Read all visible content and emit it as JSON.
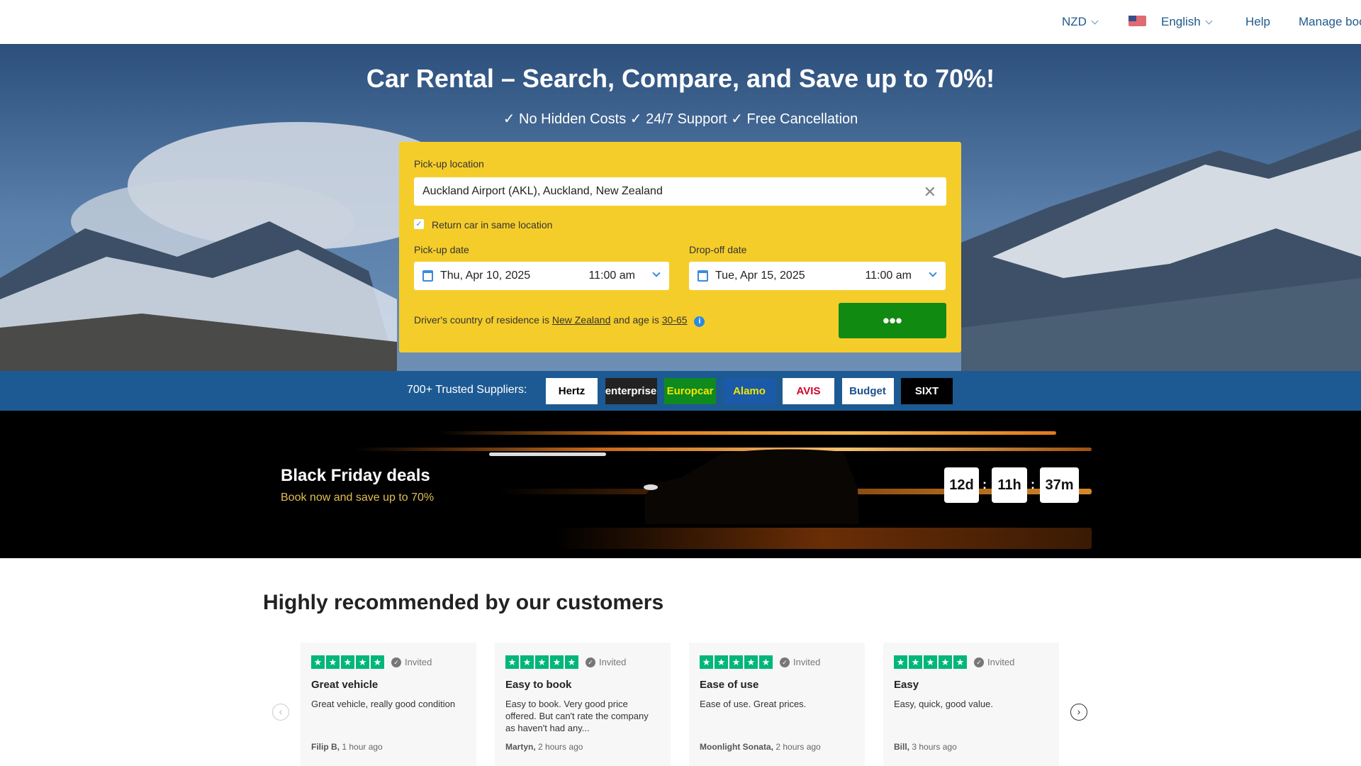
{
  "header": {
    "currency": "NZD",
    "language": "English",
    "help": "Help",
    "manage": "Manage boo"
  },
  "hero": {
    "title": "Car Rental – Search, Compare, and Save up to 70%!",
    "subtitle": "✓ No Hidden Costs ✓ 24/7 Support ✓ Free Cancellation"
  },
  "search": {
    "pickup_location_label": "Pick-up location",
    "pickup_location_value": "Auckland Airport (AKL), Auckland, New Zealand",
    "return_same_label": "Return car in same location",
    "return_same_checked": true,
    "pickup_date_label": "Pick-up date",
    "pickup_date": "Thu, Apr 10, 2025",
    "pickup_time": "11:00 am",
    "dropoff_date_label": "Drop-off date",
    "dropoff_date": "Tue, Apr 15, 2025",
    "dropoff_time": "11:00 am",
    "driver_prefix": "Driver's country of residence is",
    "driver_country": "New Zealand",
    "driver_mid": "and age is",
    "driver_age": "30-65",
    "search_button": "•••"
  },
  "suppliers": {
    "label": "700+ Trusted Suppliers:",
    "logos": [
      {
        "name": "Hertz",
        "bg": "#ffffff",
        "fg": "#000000"
      },
      {
        "name": "enterprise",
        "bg": "#222222",
        "fg": "#ffffff"
      },
      {
        "name": "Europcar",
        "bg": "#0f8a1f",
        "fg": "#f2e600"
      },
      {
        "name": "Alamo",
        "bg": "#1a5aa8",
        "fg": "#f2e600"
      },
      {
        "name": "AVIS",
        "bg": "#ffffff",
        "fg": "#d4002a"
      },
      {
        "name": "Budget",
        "bg": "#ffffff",
        "fg": "#1c4f8c"
      },
      {
        "name": "SIXT",
        "bg": "#000000",
        "fg": "#ffffff"
      }
    ]
  },
  "banner": {
    "title": "Black Friday deals",
    "subtitle": "Book now and save up to 70%",
    "countdown": [
      "12d",
      "11h",
      "37m"
    ]
  },
  "reviews": {
    "heading": "Highly recommended by our customers",
    "invited": "Invited",
    "items": [
      {
        "title": "Great vehicle",
        "text": "Great vehicle, really good condition",
        "author": "Filip B,",
        "time": "1 hour ago",
        "stars": 5
      },
      {
        "title": "Easy to book",
        "text": "Easy to book. Very good price offered. But can't rate the company as haven't had any...",
        "author": "Martyn,",
        "time": "2 hours ago",
        "stars": 5
      },
      {
        "title": "Ease of use",
        "text": "Ease of use. Great prices.",
        "author": "Moonlight Sonata,",
        "time": "2 hours ago",
        "stars": 5
      },
      {
        "title": "Easy",
        "text": "Easy, quick, good value.",
        "author": "Bill,",
        "time": "3 hours ago",
        "stars": 5
      }
    ]
  }
}
